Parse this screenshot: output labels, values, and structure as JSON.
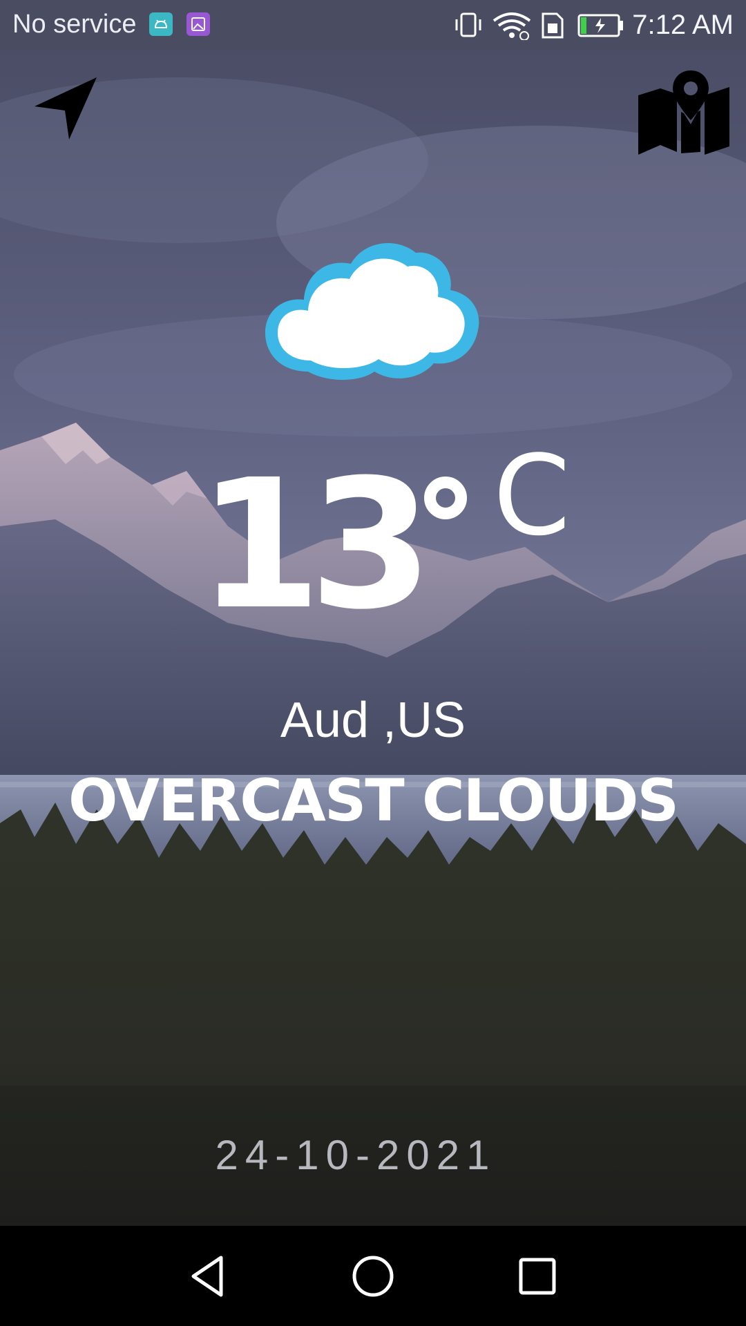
{
  "status_bar": {
    "carrier": "No service",
    "time": "7:12 AM",
    "icons": [
      "android-notification-icon",
      "gallery-notification-icon",
      "vibrate-icon",
      "wifi-icon",
      "sim-icon",
      "battery-charging-icon"
    ]
  },
  "toolbar": {
    "left_icon": "navigation-arrow-icon",
    "right_icon": "map-pin-icon"
  },
  "weather": {
    "icon": "cloud-icon",
    "temperature": "13",
    "unit": "C",
    "location": "Aud ,US",
    "description": "OVERCAST CLOUDS",
    "date": "24-10-2021"
  },
  "nav_bar": {
    "icons": [
      "back-icon",
      "home-icon",
      "recents-icon"
    ]
  },
  "colors": {
    "cloud_outline": "#3db8e6",
    "cloud_fill": "#ffffff",
    "text_primary": "#ffffff",
    "date_text": "#b8b9bf",
    "status_bar_bg": "#4a4d62",
    "nav_bar_bg": "#000000"
  }
}
